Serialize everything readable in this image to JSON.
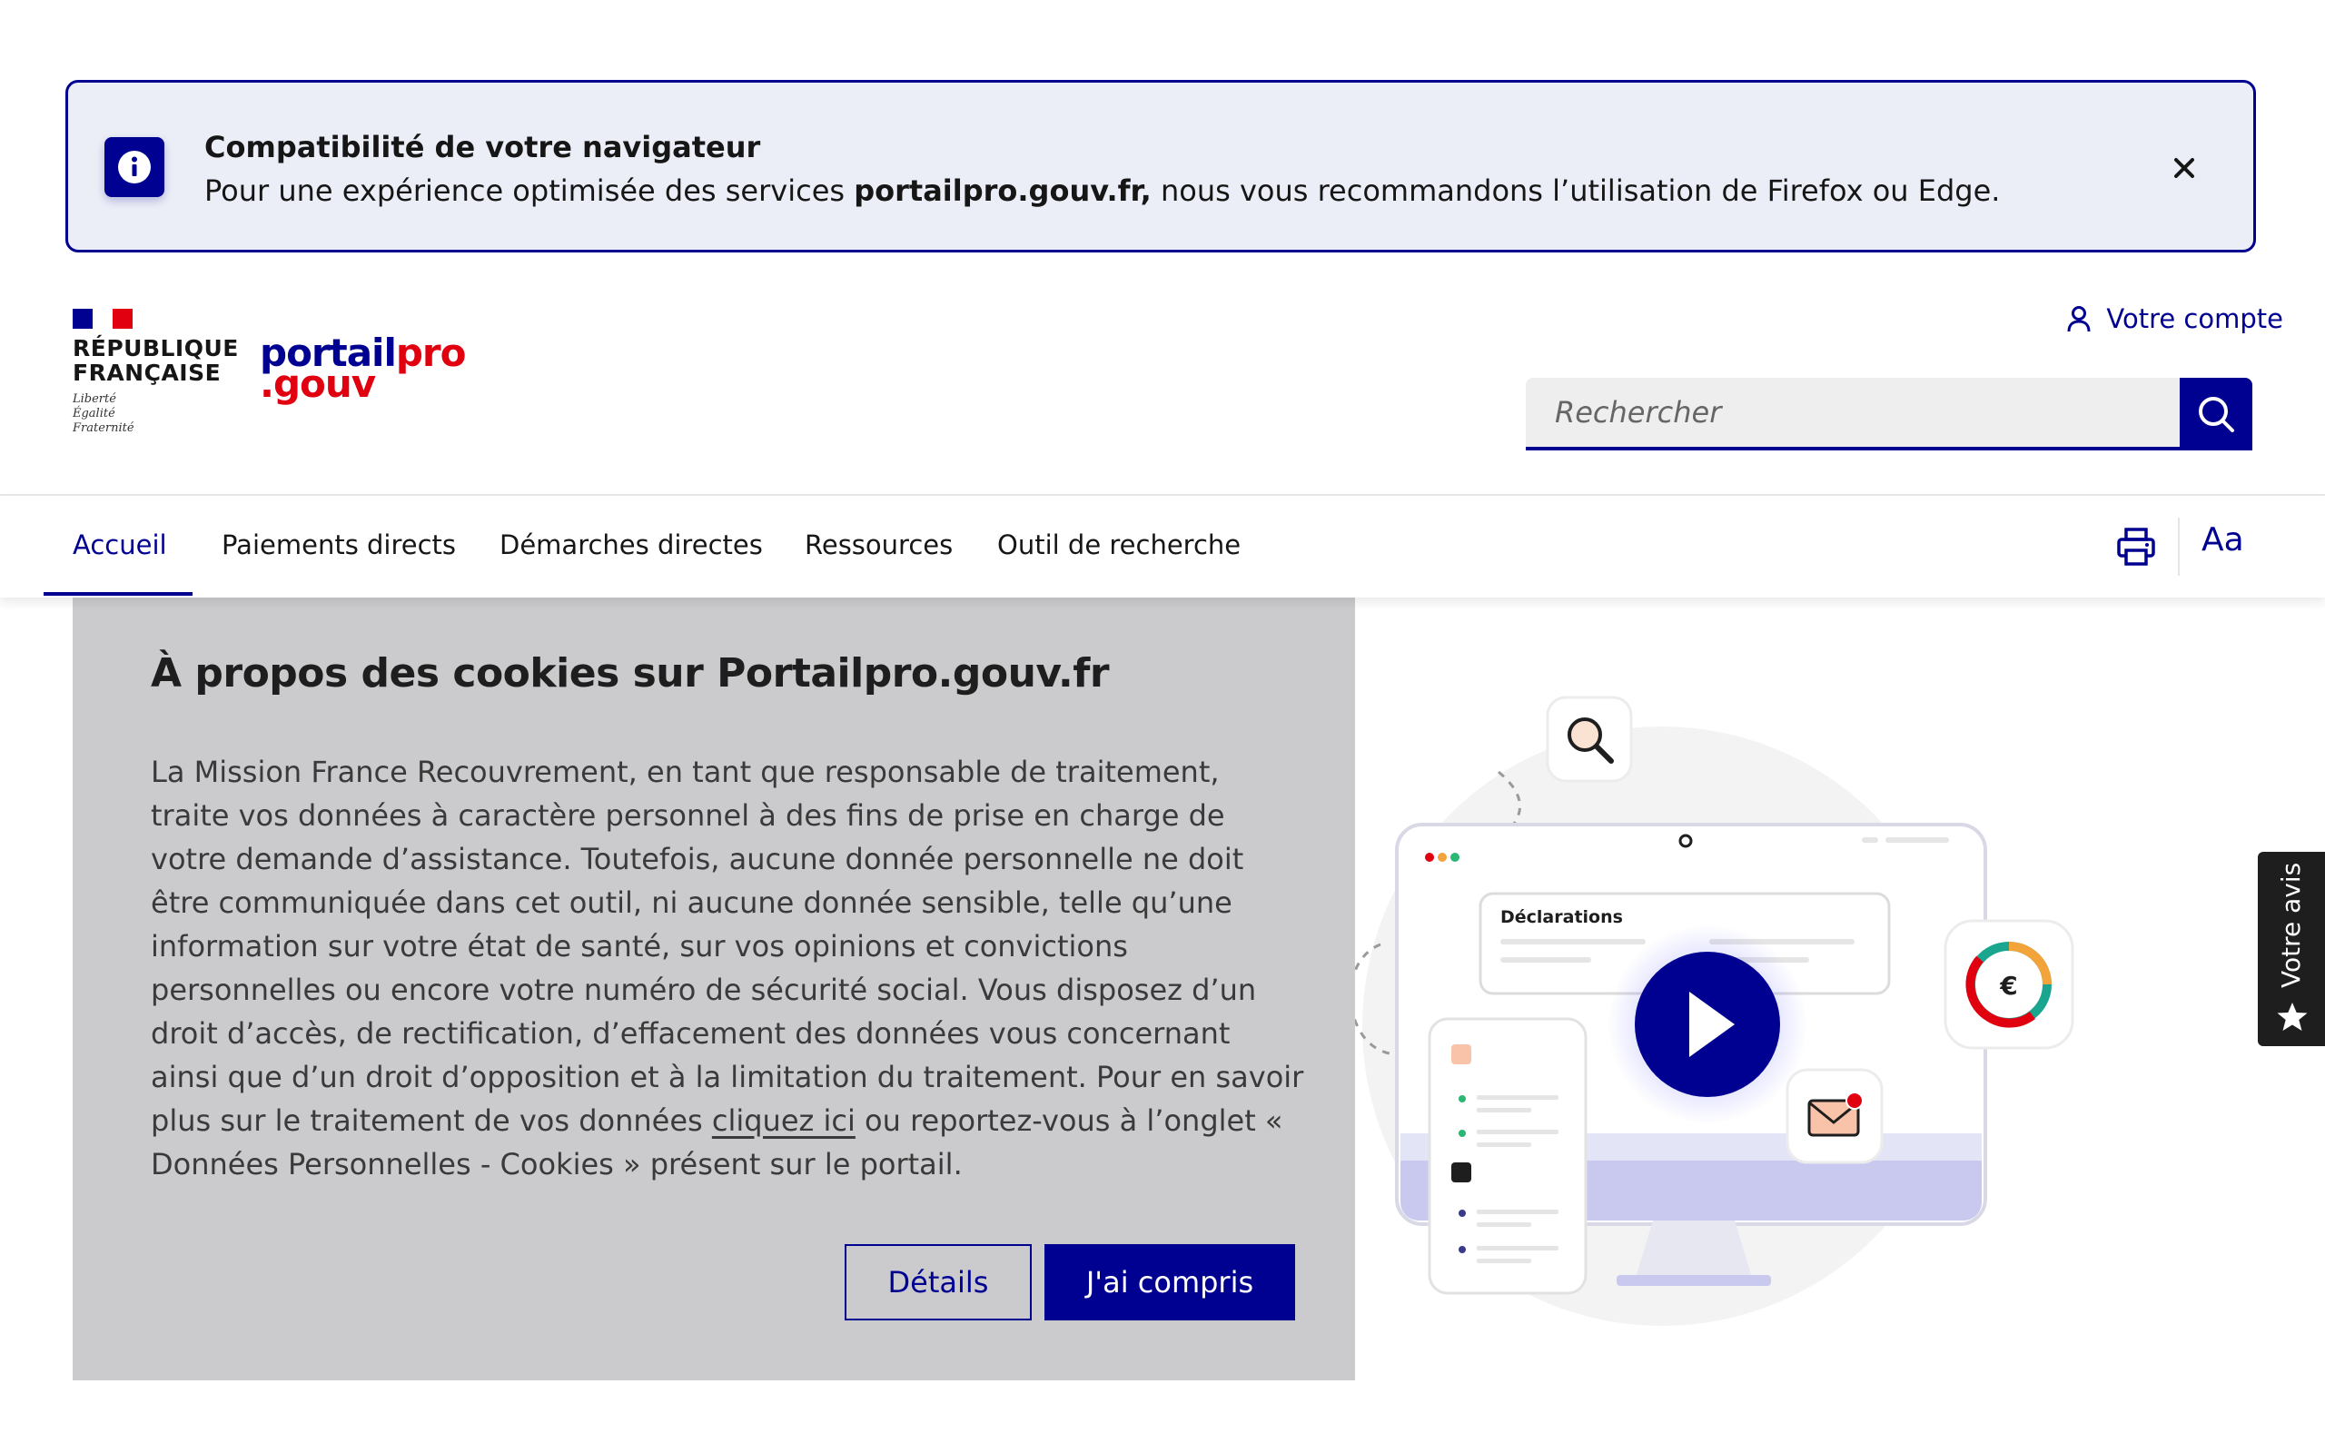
{
  "compat_banner": {
    "title": "Compatibilité de votre navigateur",
    "text_before": "Pour une expérience optimisée des services ",
    "text_bold": "portailpro.gouv.fr,",
    "text_after": " nous vous recommandons l’utilisation de Firefox ou Edge."
  },
  "header": {
    "republique_line1": "RÉPUBLIQUE",
    "republique_line2": "FRANÇAISE",
    "motto": [
      "Liberté",
      "Égalité",
      "Fraternité"
    ],
    "logo_line1_a": "portail",
    "logo_line1_b": "pro",
    "logo_line2": ".gouv",
    "account_label": "Votre compte",
    "search_placeholder": "Rechercher"
  },
  "nav": {
    "items": [
      "Accueil",
      "Paiements directs",
      "Démarches directes",
      "Ressources",
      "Outil de recherche"
    ],
    "font_size_label": "Aa"
  },
  "cookie": {
    "title": "À propos des cookies sur Portailpro.gouv.fr",
    "text_before": "La Mission France Recouvrement, en tant que responsable de traitement, traite vos données à caractère personnel à des fins de prise en charge de votre demande d’assistance. Toutefois, aucune donnée personnelle ne doit être communiquée dans cet outil, ni aucune donnée sensible, telle qu’une information sur votre état de santé, sur vos opinions et convictions personnelles ou encore votre numéro de sécurité social. Vous disposez d’un droit d’accès, de rectification, d’effacement des données vous concernant ainsi que d’un droit d’opposition et à la limitation du traitement. Pour en savoir plus sur le traitement de vos données ",
    "link": "cliquez ici",
    "text_after": " ou reportez-vous à l’onglet « Données Personnelles - Cookies » présent sur le portail.",
    "details_label": "Détails",
    "accept_label": "J'ai compris"
  },
  "illustration": {
    "card_title": "Déclarations",
    "currency_symbol": "€"
  },
  "feedback": {
    "label": "Votre avis"
  },
  "colors": {
    "brand_blue": "#000091",
    "marianne_red": "#e1000f",
    "banner_bg": "#eceef7",
    "cookie_bg": "#cbcbcd"
  },
  "icons": [
    "info-icon",
    "close-icon",
    "user-icon",
    "search-icon",
    "print-icon",
    "font-size-icon",
    "play-icon",
    "magnifier-icon",
    "mail-icon",
    "star-icon"
  ]
}
